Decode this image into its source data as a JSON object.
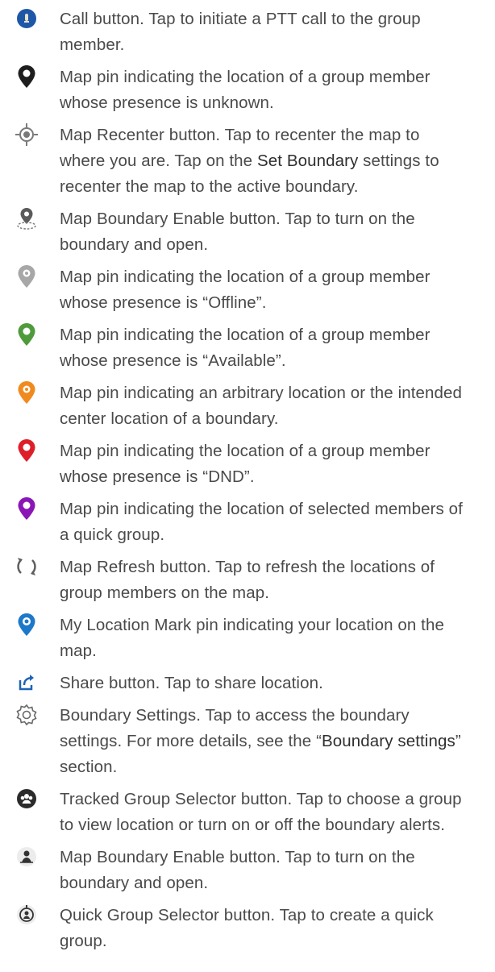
{
  "items": [
    {
      "icon": "call-button-icon",
      "text": "Call button. Tap to initiate a PTT call to the group member."
    },
    {
      "icon": "map-pin-unknown-icon",
      "text": "Map pin indicating the location of a group member whose presence is unknown."
    },
    {
      "icon": "recenter-icon",
      "text_before": "Map Recenter button. Tap to recenter the map to where you are. Tap on the ",
      "text_bold": "Set Boundary",
      "text_after": " settings to recenter the map to the active boundary."
    },
    {
      "icon": "boundary-enable-pin-icon",
      "text": "Map Boundary Enable button. Tap to turn on the boundary and open."
    },
    {
      "icon": "map-pin-offline-icon",
      "text": "Map pin indicating the location of a group member whose presence is “Offline”."
    },
    {
      "icon": "map-pin-available-icon",
      "text": "Map pin indicating the location of a group member whose presence is “Available”."
    },
    {
      "icon": "map-pin-arbitrary-icon",
      "text": "Map pin indicating an arbitrary location or the intended center location of a boundary."
    },
    {
      "icon": "map-pin-dnd-icon",
      "text": "Map pin indicating the location of a group member whose presence is “DND”."
    },
    {
      "icon": "map-pin-quick-group-icon",
      "text": "Map pin indicating the location of selected members of a quick group."
    },
    {
      "icon": "refresh-icon",
      "text": "Map Refresh button. Tap to refresh the locations of group members on the map."
    },
    {
      "icon": "my-location-pin-icon",
      "text": "My Location Mark pin indicating your location on the map."
    },
    {
      "icon": "share-icon",
      "text": "Share button. Tap to share location."
    },
    {
      "icon": "settings-gear-icon",
      "text_before": "Boundary Settings. Tap to access the boundary settings. For more details, see the “",
      "text_bold": "Boundary settings",
      "text_after": "” section."
    },
    {
      "icon": "tracked-group-selector-icon",
      "text": "Tracked Group Selector button. Tap to choose a group to view location or turn on or off the boundary alerts."
    },
    {
      "icon": "boundary-enable-button-icon",
      "text": "Map Boundary Enable button. Tap to turn on the boundary and open."
    },
    {
      "icon": "quick-group-selector-icon",
      "text": "Quick Group Selector button. Tap to create a quick group."
    }
  ],
  "colors": {
    "call_blue": "#1f57a8",
    "unknown_black": "#1e1e1e",
    "offline_gray": "#a7a7a7",
    "available_green": "#4f9b3c",
    "arbitrary_orange": "#f08a1e",
    "dnd_red": "#dd1f2a",
    "quick_purple": "#8a17b5",
    "my_location_blue": "#1d78c9",
    "share_blue": "#1e63b5",
    "text": "#4a4a4a"
  }
}
